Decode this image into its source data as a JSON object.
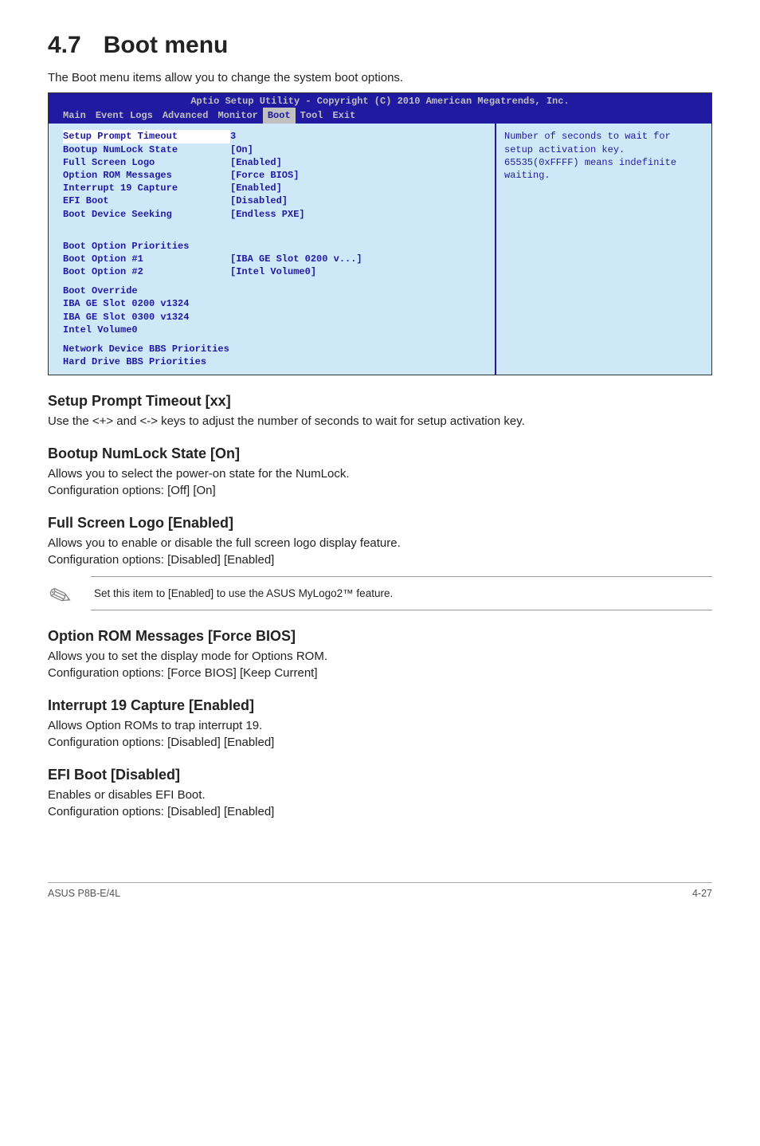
{
  "heading": {
    "num": "4.7",
    "title": "Boot menu"
  },
  "intro": "The Boot menu items allow you to change the system boot options.",
  "bios": {
    "title": "Aptio Setup Utility - Copyright (C) 2010 American Megatrends, Inc.",
    "tabs": [
      "Main",
      "Event Logs",
      "Advanced",
      "Monitor",
      "Boot",
      "Tool",
      "Exit"
    ],
    "selected_tab": "Boot",
    "rows": [
      {
        "label": "Setup Prompt Timeout",
        "value": "3",
        "selected": true
      },
      {
        "label": "Bootup NumLock State",
        "value": "[On]"
      },
      {
        "label": "Full Screen Logo",
        "value": "[Enabled]"
      },
      {
        "label": "Option ROM Messages",
        "value": "[Force BIOS]"
      },
      {
        "label": "Interrupt 19 Capture",
        "value": "[Enabled]"
      },
      {
        "label": "EFI Boot",
        "value": "[Disabled]"
      },
      {
        "label": "Boot Device Seeking",
        "value": "[Endless PXE]"
      }
    ],
    "priorities_heading": "Boot Option Priorities",
    "priorities": [
      {
        "label": "Boot Option #1",
        "value": "[IBA GE Slot 0200 v...]"
      },
      {
        "label": "Boot Option #2",
        "value": "[Intel Volume0]"
      }
    ],
    "override_heading": "Boot Override",
    "override_items": [
      "IBA GE Slot 0200 v1324",
      "IBA GE Slot 0300 v1324",
      "Intel Volume0"
    ],
    "extra_items": [
      "Network Device BBS Priorities",
      "Hard Drive BBS Priorities"
    ],
    "help": "Number of seconds to wait for setup activation key. 65535(0xFFFF) means indefinite waiting."
  },
  "sections": [
    {
      "title": "Setup Prompt Timeout [xx]",
      "paras": [
        "Use the <+> and <-> keys to adjust the number of seconds to wait for setup activation key."
      ]
    },
    {
      "title": "Bootup NumLock State [On]",
      "paras": [
        "Allows you to select the power-on state for the NumLock.",
        "Configuration options: [Off] [On]"
      ]
    },
    {
      "title": "Full Screen Logo [Enabled]",
      "paras": [
        "Allows you to enable or disable the full screen logo display feature.",
        "Configuration options: [Disabled] [Enabled]"
      ],
      "note": "Set this item to [Enabled] to use the ASUS MyLogo2™ feature."
    },
    {
      "title": "Option ROM Messages [Force BIOS]",
      "paras": [
        "Allows you to set the display mode for Options ROM.",
        "Configuration options: [Force BIOS] [Keep Current]"
      ]
    },
    {
      "title": "Interrupt 19 Capture [Enabled]",
      "paras": [
        "Allows Option ROMs to trap interrupt 19.",
        "Configuration options: [Disabled] [Enabled]"
      ]
    },
    {
      "title": "EFI Boot [Disabled]",
      "paras": [
        "Enables or disables EFI Boot.",
        "Configuration options: [Disabled] [Enabled]"
      ]
    }
  ],
  "footer": {
    "left": "ASUS P8B-E/4L",
    "right": "4-27"
  }
}
